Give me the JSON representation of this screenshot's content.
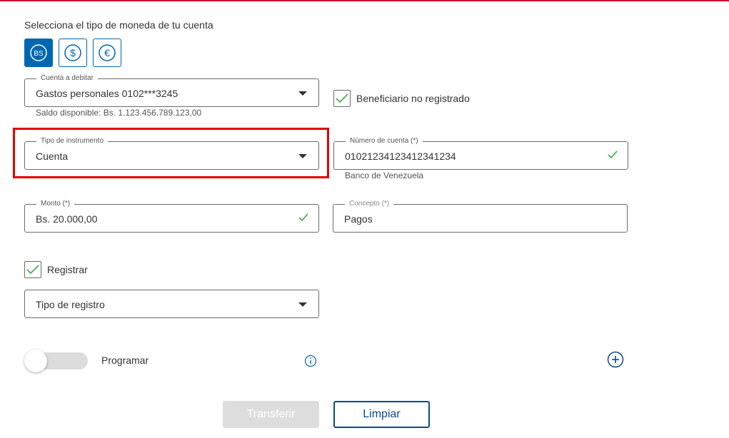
{
  "heading": "Selecciona el tipo de moneda de tu cuenta",
  "currency_options": [
    {
      "icon": "bs-currency-icon",
      "label": "BS"
    },
    {
      "icon": "dollar-currency-icon",
      "label": "$"
    },
    {
      "icon": "euro-currency-icon",
      "label": "€"
    }
  ],
  "cuenta_debitar": {
    "label": "Cuenta a debitar",
    "value": "Gastos personales 0102***3245",
    "helper": "Saldo disponible: Bs. 1.123.456.789.123,00"
  },
  "beneficiario": {
    "label": "Beneficiario no registrado",
    "checked": true
  },
  "tipo_instrumento": {
    "label": "Tipo de instrumento",
    "value": "Cuenta"
  },
  "numero_cuenta": {
    "label": "Número de cuenta (*)",
    "value": "01021234123412341234",
    "helper": "Banco de Venezuela"
  },
  "monto": {
    "label": "Monto (*)",
    "value": "Bs. 20.000,00"
  },
  "concepto": {
    "label": "Concepto (*)",
    "value": "Pagos"
  },
  "registrar": {
    "label": "Registrar",
    "checked": true
  },
  "tipo_registro": {
    "placeholder": "Tipo de registro"
  },
  "programar": {
    "label": "Programar",
    "enabled": false
  },
  "buttons": {
    "transfer": "Transferir",
    "clear": "Limpiar"
  },
  "colors": {
    "primary": "#0067b1",
    "success": "#4caf50",
    "highlight": "#e00000",
    "top_bar": "#c8102e"
  }
}
